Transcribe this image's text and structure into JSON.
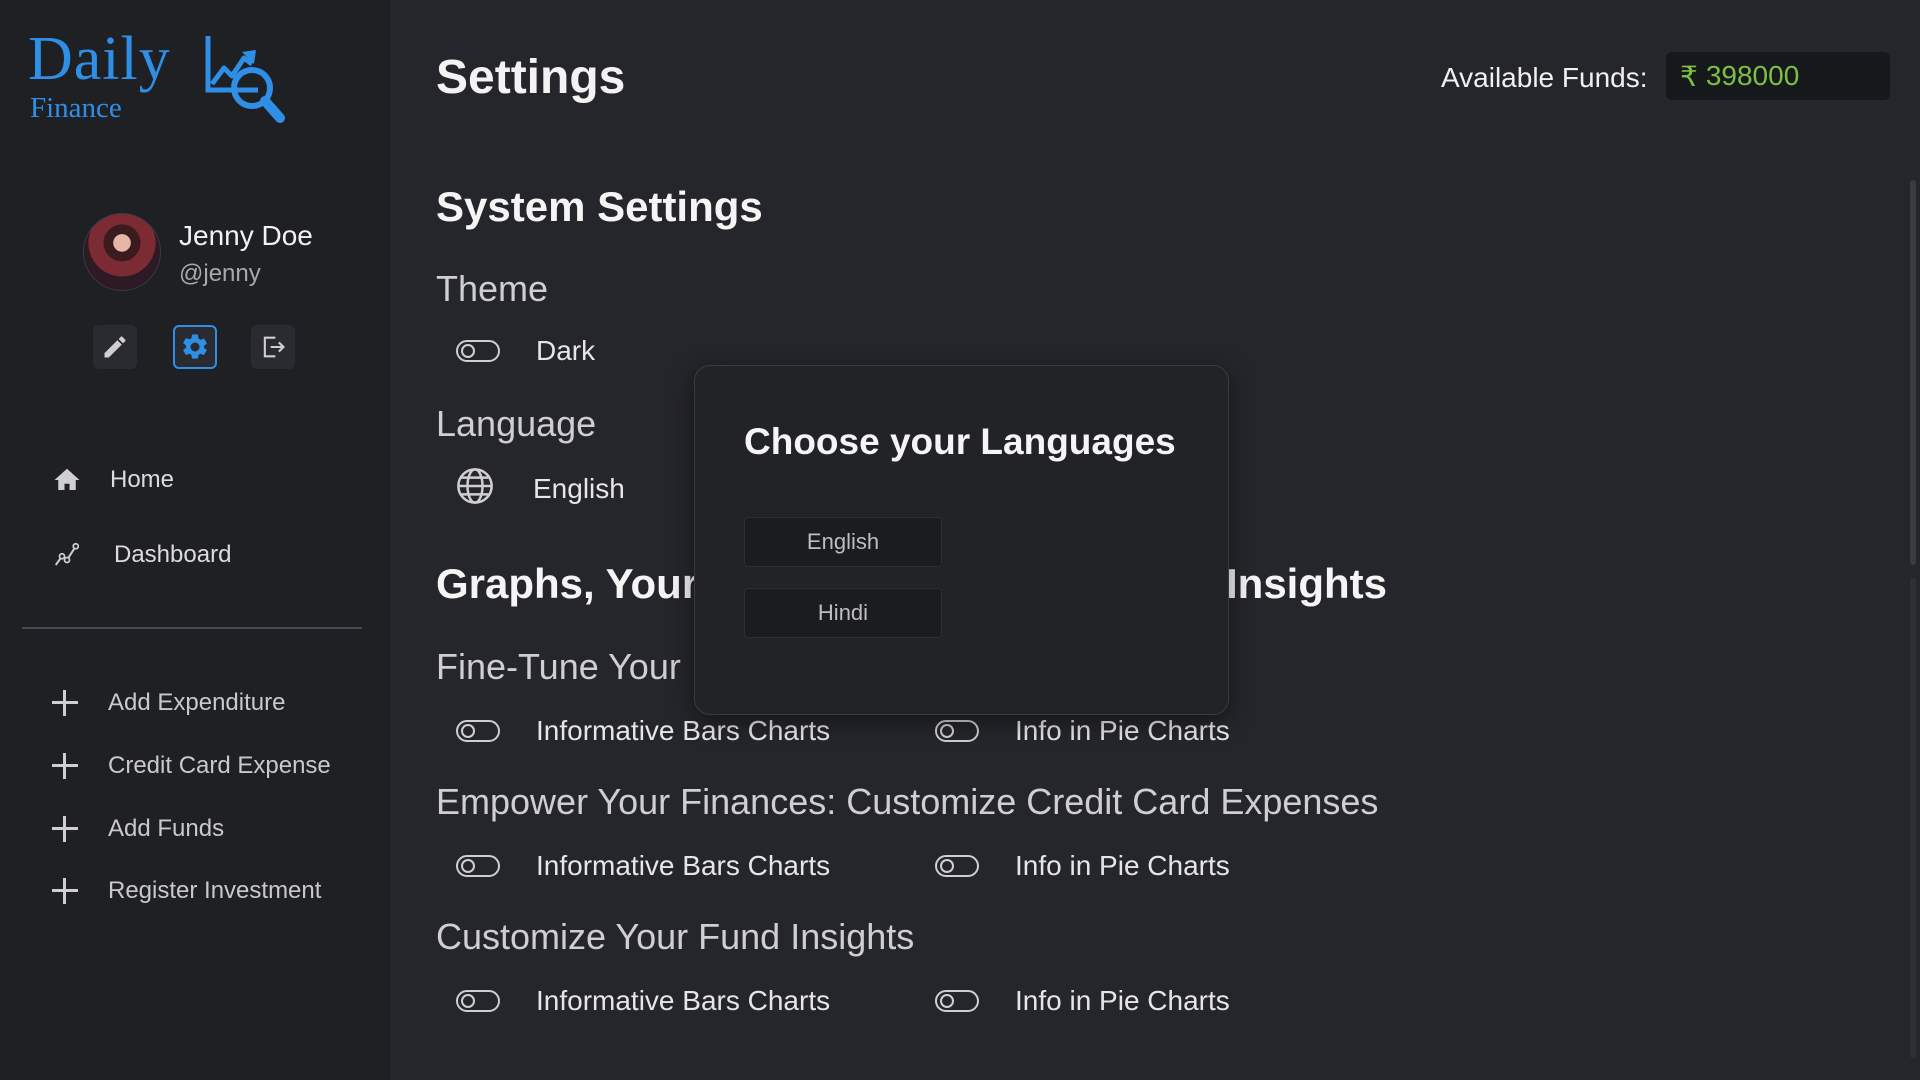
{
  "logo": {
    "line1": "Daily",
    "line2": "Finance"
  },
  "user": {
    "name": "Jenny Doe",
    "handle": "@jenny"
  },
  "quick_actions": [
    {
      "icon": "pencil-icon",
      "label": "Edit"
    },
    {
      "icon": "gear-icon",
      "label": "Settings",
      "active": true
    },
    {
      "icon": "logout-icon",
      "label": "Logout"
    }
  ],
  "nav": [
    {
      "icon": "home-icon",
      "label": "Home"
    },
    {
      "icon": "chart-line-icon",
      "label": "Dashboard"
    }
  ],
  "actions": [
    {
      "label": "Add Expenditure"
    },
    {
      "label": "Credit Card Expense"
    },
    {
      "label": "Add Funds"
    },
    {
      "label": "Register Investment"
    }
  ],
  "header": {
    "title": "Settings",
    "funds_label": "Available Funds:",
    "currency": "₹",
    "funds_value": "398000"
  },
  "system": {
    "heading": "System Settings",
    "theme_label": "Theme",
    "theme_toggle": "Dark",
    "language_label": "Language",
    "language_value": "English"
  },
  "graphs": {
    "heading_left": "Graphs, Your ",
    "heading_right": "Insights",
    "section1_title": "Fine-Tune Your ",
    "section2_title": "Empower Your Finances: Customize Credit Card Expenses",
    "section3_title": "Customize Your Fund Insights",
    "bar_label": "Informative Bars Charts",
    "pie_label": "Info in Pie Charts"
  },
  "modal": {
    "title": "Choose your Languages",
    "options": [
      "English",
      "Hindi"
    ]
  },
  "colors": {
    "accent": "#2f8fe6",
    "funds_green": "#7bc043",
    "sidebar_bg": "#1f2024",
    "main_bg": "#25262b"
  }
}
